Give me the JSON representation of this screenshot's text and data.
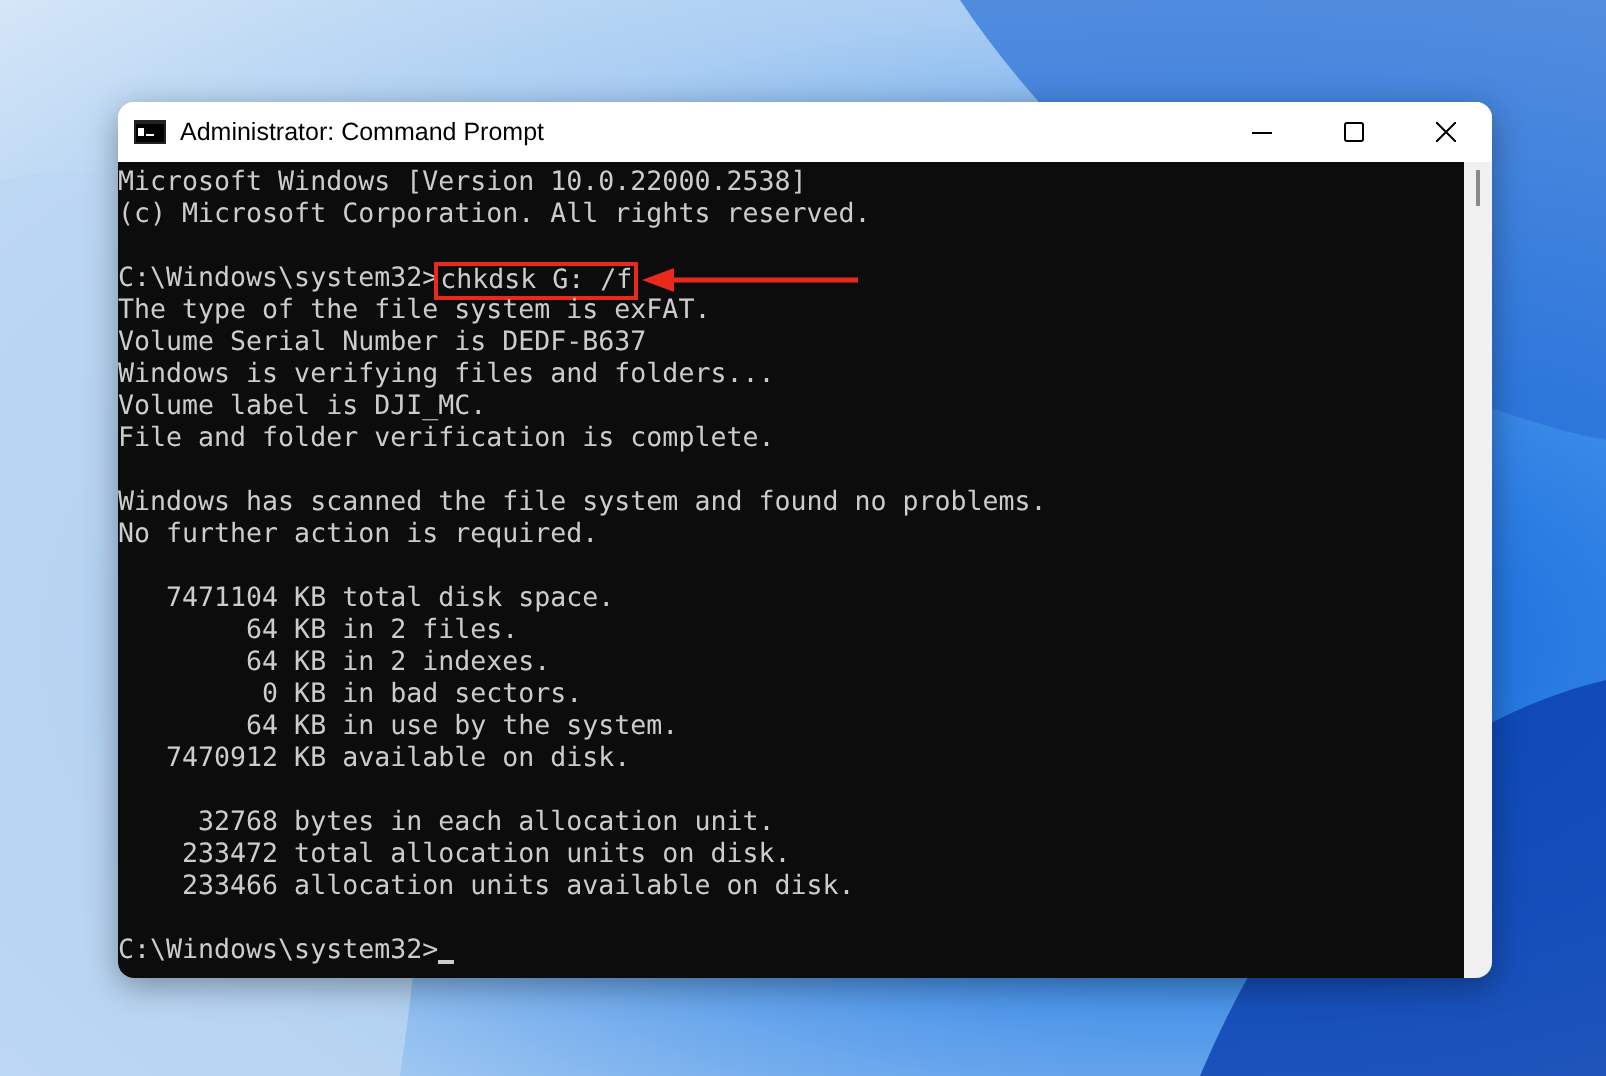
{
  "window": {
    "title": "Administrator: Command Prompt"
  },
  "console": {
    "lines": [
      {
        "kind": "text",
        "text": "Microsoft Windows [Version 10.0.22000.2538]"
      },
      {
        "kind": "text",
        "text": "(c) Microsoft Corporation. All rights reserved."
      },
      {
        "kind": "blank"
      },
      {
        "kind": "command",
        "prompt": "C:\\Windows\\system32>",
        "command": "chkdsk G: /f"
      },
      {
        "kind": "text",
        "text": "The type of the file system is exFAT."
      },
      {
        "kind": "text",
        "text": "Volume Serial Number is DEDF-B637"
      },
      {
        "kind": "text",
        "text": "Windows is verifying files and folders..."
      },
      {
        "kind": "text",
        "text": "Volume label is DJI_MC."
      },
      {
        "kind": "text",
        "text": "File and folder verification is complete."
      },
      {
        "kind": "blank"
      },
      {
        "kind": "text",
        "text": "Windows has scanned the file system and found no problems."
      },
      {
        "kind": "text",
        "text": "No further action is required."
      },
      {
        "kind": "blank"
      },
      {
        "kind": "text",
        "text": "   7471104 KB total disk space."
      },
      {
        "kind": "text",
        "text": "        64 KB in 2 files."
      },
      {
        "kind": "text",
        "text": "        64 KB in 2 indexes."
      },
      {
        "kind": "text",
        "text": "         0 KB in bad sectors."
      },
      {
        "kind": "text",
        "text": "        64 KB in use by the system."
      },
      {
        "kind": "text",
        "text": "   7470912 KB available on disk."
      },
      {
        "kind": "blank"
      },
      {
        "kind": "text",
        "text": "     32768 bytes in each allocation unit."
      },
      {
        "kind": "text",
        "text": "    233472 total allocation units on disk."
      },
      {
        "kind": "text",
        "text": "    233466 allocation units available on disk."
      },
      {
        "kind": "blank"
      },
      {
        "kind": "prompt",
        "prompt": "C:\\Windows\\system32>"
      }
    ]
  }
}
